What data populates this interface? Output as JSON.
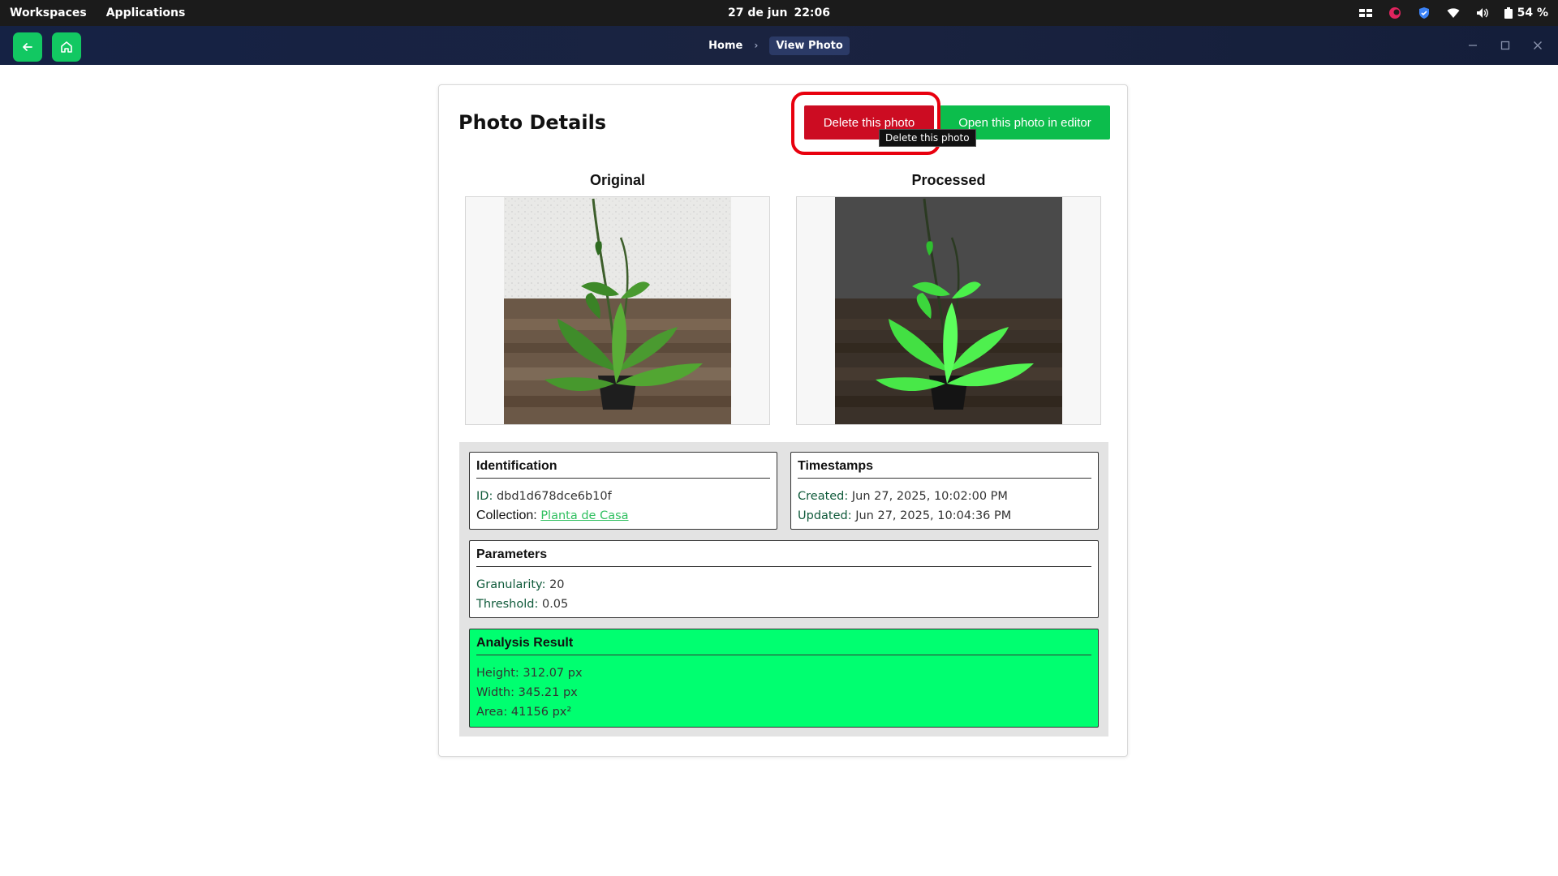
{
  "system_bar": {
    "workspaces": "Workspaces",
    "applications": "Applications",
    "date": "27 de jun",
    "time": "22:06",
    "battery": "54 %"
  },
  "app_bar": {
    "breadcrumbs": [
      "Home",
      "View Photo"
    ],
    "accent_color": "#12c862"
  },
  "page": {
    "title": "Photo Details",
    "delete_button": "Delete this photo",
    "editor_button": "Open this photo in editor",
    "tooltip": "Delete this photo",
    "original_label": "Original",
    "processed_label": "Processed"
  },
  "identification": {
    "title": "Identification",
    "id_label": "ID:",
    "id_value": "dbd1d678dce6b10f",
    "collection_label": "Collection:",
    "collection_value": "Planta de Casa"
  },
  "timestamps": {
    "title": "Timestamps",
    "created_label": "Created:",
    "created_value": "Jun 27, 2025, 10:02:00 PM",
    "updated_label": "Updated:",
    "updated_value": "Jun 27, 2025, 10:04:36 PM"
  },
  "parameters": {
    "title": "Parameters",
    "granularity_label": "Granularity:",
    "granularity_value": "20",
    "threshold_label": "Threshold:",
    "threshold_value": "0.05"
  },
  "analysis": {
    "title": "Analysis Result",
    "height": "Height: 312.07 px",
    "width": "Width: 345.21 px",
    "area": "Area: 41156 px²"
  },
  "colors": {
    "delete": "#cc0c22",
    "editor": "#0cbd4c",
    "result_bg": "#00ff70",
    "highlight": "#e8000e"
  }
}
